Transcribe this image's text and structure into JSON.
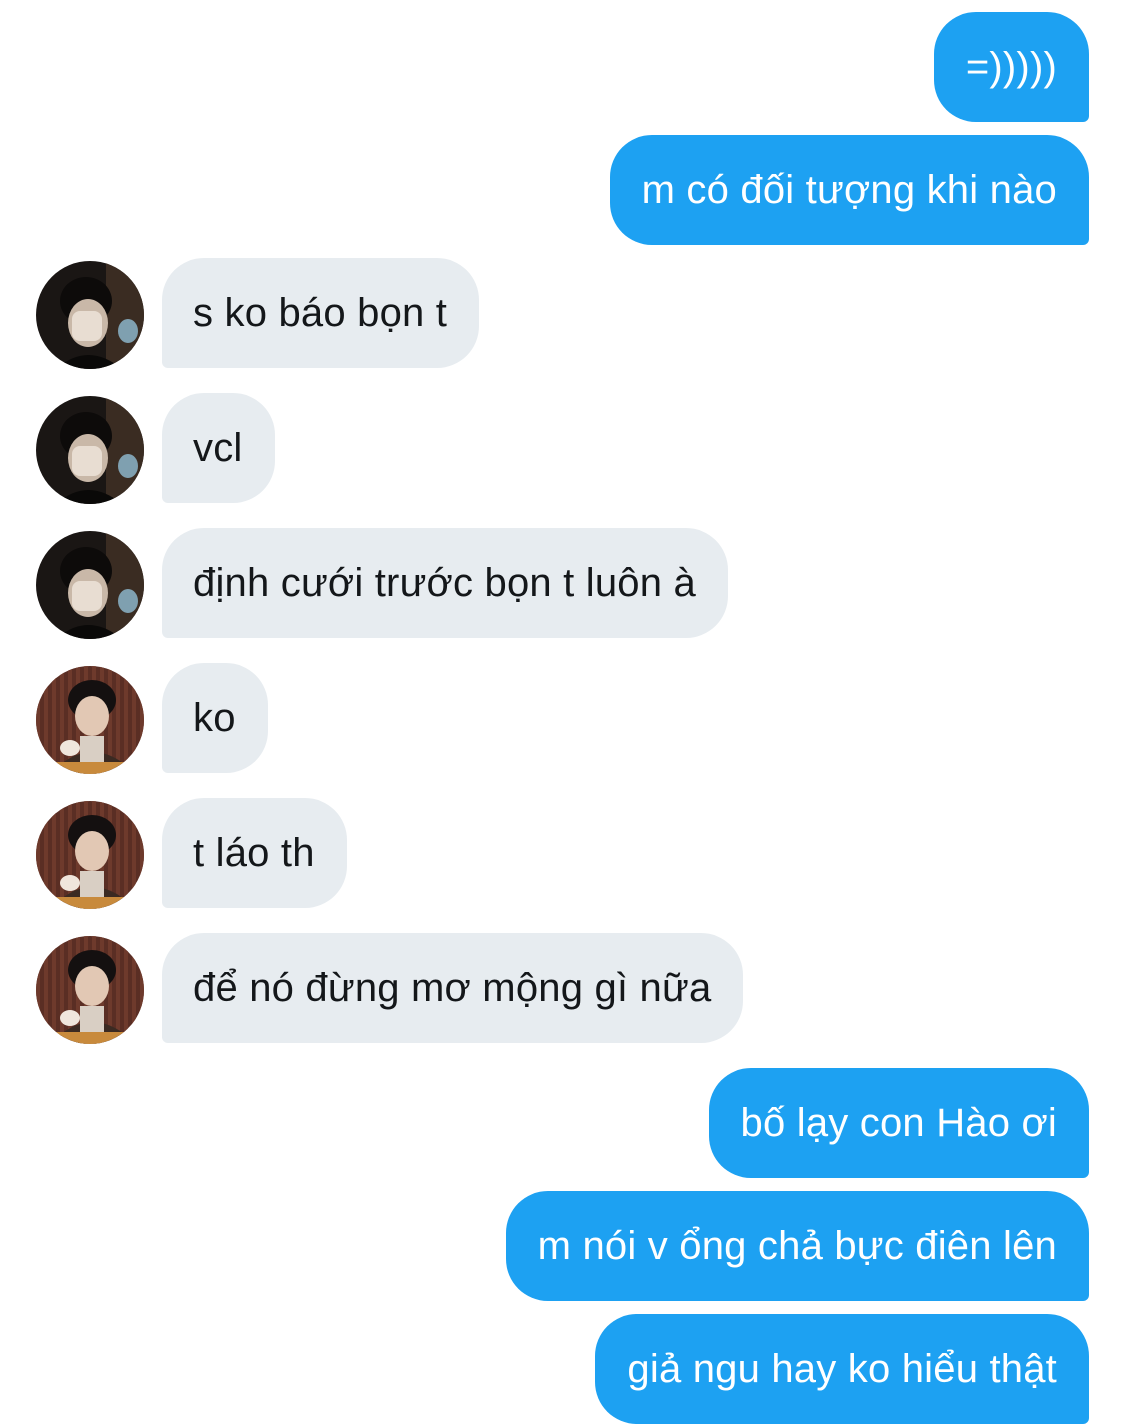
{
  "conversation": {
    "messages": [
      {
        "direction": "outgoing",
        "text": "=)))))"
      },
      {
        "direction": "outgoing",
        "text": "m có đối tượng khi nào"
      },
      {
        "direction": "incoming",
        "sender_avatar": "avatar-a",
        "text": "s ko báo bọn t"
      },
      {
        "direction": "incoming",
        "sender_avatar": "avatar-a",
        "text": "vcl"
      },
      {
        "direction": "incoming",
        "sender_avatar": "avatar-a",
        "text": "định cưới trước bọn t luôn à"
      },
      {
        "direction": "incoming",
        "sender_avatar": "avatar-b",
        "text": "ko"
      },
      {
        "direction": "incoming",
        "sender_avatar": "avatar-b",
        "text": "t láo th"
      },
      {
        "direction": "incoming",
        "sender_avatar": "avatar-b",
        "text": "để nó đừng mơ mộng gì nữa"
      },
      {
        "direction": "outgoing",
        "text": "bố lạy con Hào ơi"
      },
      {
        "direction": "outgoing",
        "text": "m nói v ổng chả bực điên lên"
      },
      {
        "direction": "outgoing",
        "text": "giả ngu hay ko hiểu thật"
      }
    ]
  },
  "colors": {
    "outgoing_bubble": "#1da1f2",
    "outgoing_text": "#ffffff",
    "incoming_bubble": "#e7ecf0",
    "incoming_text": "#14171a",
    "background": "#ffffff"
  }
}
